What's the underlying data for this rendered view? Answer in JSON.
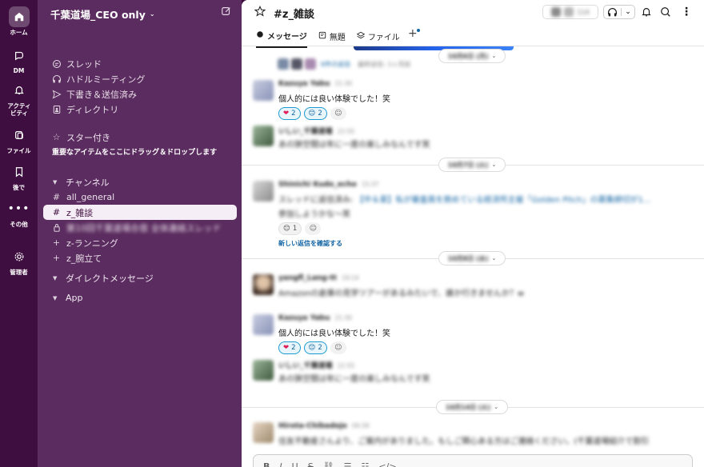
{
  "rail": {
    "items": [
      {
        "label": "ホーム"
      },
      {
        "label": "DM"
      },
      {
        "label": "アクティビティ"
      },
      {
        "label": "ファイル"
      },
      {
        "label": "後で"
      },
      {
        "label": "その他"
      },
      {
        "label": "管理者"
      }
    ]
  },
  "sidebar": {
    "workspace": "千葉道場_CEO only",
    "nav": [
      {
        "label": "スレッド",
        "icon": "thread-icon"
      },
      {
        "label": "ハドルミーティング",
        "icon": "headphones-icon"
      },
      {
        "label": "下書き＆送信済み",
        "icon": "send-icon"
      },
      {
        "label": "ディレクトリ",
        "icon": "directory-icon"
      }
    ],
    "starred_label": "スター付き",
    "starred_hint": "重要なアイテムをここにドラッグ＆ドロップします",
    "channels_label": "チャンネル",
    "channels": [
      {
        "prefix": "#",
        "name": "all_general"
      },
      {
        "prefix": "#",
        "name": "z_雑談"
      },
      {
        "prefix": "🔒",
        "name": "第10回千葉道場合宿 全体連絡スレッド"
      },
      {
        "prefix": "+",
        "name": "z-ランニング"
      },
      {
        "prefix": "+",
        "name": "z_腕立て"
      }
    ],
    "dm_label": "ダイレクトメッセージ",
    "app_label": "App"
  },
  "header": {
    "channel": "#z_雑談",
    "member_count": "114",
    "tabs": [
      {
        "label": "メッセージ"
      },
      {
        "label": "無題"
      },
      {
        "label": "ファイル"
      }
    ],
    "tab_add": "+"
  },
  "thread_info": {
    "replies": "6件の返信",
    "last": "最終返信: 1ヶ月前"
  },
  "dates": {
    "d1": "10月6日 (月)",
    "d2": "10月7日 (火)",
    "d3": "10月8日 (水)",
    "d4": "10月14日 (火)"
  },
  "messages": [
    {
      "name": "Kazuya Yabu",
      "time": "21:30",
      "text": "個人的には良い体験でした！笑",
      "reactions": [
        {
          "emoji": "❤",
          "count": "2"
        },
        {
          "emoji": "😊",
          "count": "2"
        }
      ]
    },
    {
      "name": "いしい_千葉道場",
      "time": "22:55",
      "text": "あの狭空間は年に一度の楽しみなんです笑"
    },
    {
      "name": "Shinichi Kudo_echo",
      "time": "15:37",
      "text_prefix": "スレッドに返信済み:",
      "text_link": "【中＆豪】私が審査員を務めている経済所主催「Golden Pitch」の募集締切が1...",
      "text2": "参加しようかな〜笑",
      "reactions": [
        {
          "emoji": "😊",
          "count": "1"
        }
      ],
      "new_replies": "新しい返信を確認する"
    },
    {
      "name": "yangfl_Lang-tt",
      "time": "19:14",
      "text": "Amazonの倉庫の見学ツアーがあるみたいで、誰か行きませんか？w"
    },
    {
      "name": "Kazuya Yabu",
      "time": "21:30",
      "text": "個人的には良い体験でした！笑",
      "reactions": [
        {
          "emoji": "❤",
          "count": "2"
        },
        {
          "emoji": "😊",
          "count": "2"
        }
      ]
    },
    {
      "name": "いしい_千葉道場",
      "time": "22:55",
      "text": "あの狭空間は年に一度の楽しみなんです笑"
    },
    {
      "name": "Hirota-Chibadojo",
      "time": "09:39",
      "text": "住友不動産さんより、ご案内がありました。もしご関心ある方はご連絡ください。(千葉道場紹介で割引"
    }
  ],
  "composer": {
    "tools": [
      "B",
      "I",
      "U",
      "S"
    ]
  },
  "colors": {
    "aubergine": "#3f0e40",
    "sidebar": "#5b2c5f",
    "link": "#1264a3"
  }
}
